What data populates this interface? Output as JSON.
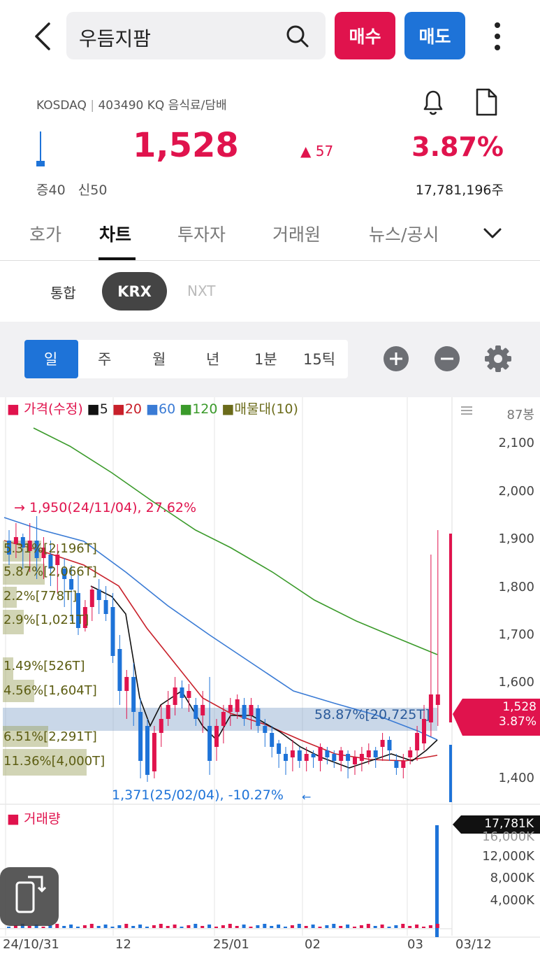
{
  "header": {
    "search_text": "우듬지팜",
    "buy_label": "매수",
    "sell_label": "매도"
  },
  "stock": {
    "market": "KOSDAQ",
    "code_sector": "403490 KQ 음식료/담배",
    "price": "1,528",
    "change": "57",
    "change_pct": "3.87%",
    "margin_rate": "증40",
    "credit_rate": "신50",
    "volume": "17,781,196주"
  },
  "tabs": [
    "호가",
    "차트",
    "투자자",
    "거래원",
    "뉴스/공시"
  ],
  "exchange": {
    "options": [
      "통합",
      "KRX",
      "NXT"
    ],
    "selected": "KRX"
  },
  "periods": [
    "일",
    "주",
    "월",
    "년",
    "1분",
    "15틱"
  ],
  "chart_top": {
    "legend": {
      "price": "가격(수정)",
      "ma5": "5",
      "ma20": "20",
      "ma60": "60",
      "ma120": "120",
      "profile": "매물대(10)"
    },
    "bar_count": "87봉",
    "yticks": [
      "2,100",
      "2,000",
      "1,900",
      "1,800",
      "1,700",
      "1,600",
      "1,400"
    ],
    "high_label": "1,950(24/11/04), 27.62%",
    "low_label": "1,371(25/02/04), -10.27%",
    "current_price": "1,528",
    "current_pct": "3.87%",
    "profile_labels": [
      "5.31%[2,196T]",
      "5.87%[2,066T]",
      "2.2%[778T]",
      "2.9%[1,021T]",
      "1.49%[526T]",
      "4.56%[1,604T]",
      "58.87%[20,725T]",
      "6.51%[2,291T]",
      "11.36%[4,000T]"
    ]
  },
  "chart_bottom": {
    "title": "거래량",
    "current_volume": "17,781K",
    "yticks": [
      "16,000K",
      "12,000K",
      "8,000K",
      "4,000K"
    ]
  },
  "xticks": [
    "24/10/31",
    "12",
    "25/01",
    "02",
    "03",
    "03/12"
  ],
  "colors": {
    "up": "#e0134d",
    "down": "#1e73d8",
    "ma5": "#111111",
    "ma20": "#c8202a",
    "ma60": "#3a7bd5",
    "ma120": "#3a9a2a",
    "profile": "#9aa05c"
  },
  "chart_data": {
    "type": "candlestick",
    "x_range": [
      "24/10/31",
      "25/03/12"
    ],
    "ylim": [
      1350,
      2150
    ],
    "last_close": 1528,
    "annotated_high": {
      "date": "24/11/04",
      "value": 1950
    },
    "annotated_low": {
      "date": "25/02/04",
      "value": 1371
    },
    "profile_zone_price": [
      1540,
      1580
    ]
  }
}
